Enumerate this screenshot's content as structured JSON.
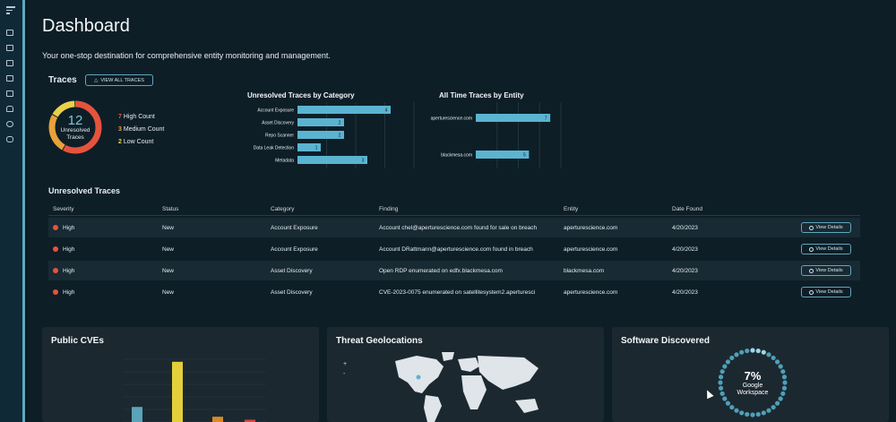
{
  "page": {
    "title": "Dashboard",
    "subtitle": "Your one-stop destination for comprehensive entity monitoring and management."
  },
  "sidebar": {
    "icons": [
      "menu-icon",
      "dashboard-icon",
      "list-icon",
      "report-icon",
      "layers-icon",
      "table-icon",
      "bell-icon",
      "gear-icon",
      "users-icon"
    ]
  },
  "traces": {
    "title": "Traces",
    "view_all": "VIEW ALL TRACES",
    "total": "12",
    "total_label": "Unresolved Traces",
    "counts": [
      {
        "n": "7",
        "label": "High Count",
        "color": "#e5533d"
      },
      {
        "n": "3",
        "label": "Medium Count",
        "color": "#e8a13a"
      },
      {
        "n": "2",
        "label": "Low Count",
        "color": "#e8d04a"
      }
    ],
    "donut": {
      "high": 7,
      "medium": 3,
      "low": 2,
      "colors": {
        "high": "#e5533d",
        "medium": "#e8a13a",
        "low": "#e8d04a"
      }
    }
  },
  "chart_data": [
    {
      "type": "bar",
      "orientation": "horizontal",
      "title": "Unresolved Traces by Category",
      "categories": [
        "Account Exposure",
        "Asset Discovery",
        "Repo Scanner",
        "Data Leak Detection",
        "Metadata"
      ],
      "values": [
        4,
        2,
        2,
        1,
        3
      ],
      "xlim": [
        0,
        5
      ],
      "color": "#5ab4d1"
    },
    {
      "type": "bar",
      "orientation": "horizontal",
      "title": "All Time Traces by Entity",
      "categories": [
        "aperturescience.com",
        "blackmesa.com"
      ],
      "values": [
        7,
        5
      ],
      "xlim": [
        0,
        8
      ],
      "color": "#5ab4d1"
    }
  ],
  "unresolved": {
    "title": "Unresolved Traces",
    "columns": [
      "Severity",
      "Status",
      "Category",
      "Finding",
      "Entity",
      "Date Found"
    ],
    "button_label": "View Details",
    "rows": [
      {
        "severity": "High",
        "status": "New",
        "category": "Account Exposure",
        "finding": "Account chel@aperturescience.com found for sale on breach",
        "entity": "aperturescience.com",
        "date": "4/20/2023"
      },
      {
        "severity": "High",
        "status": "New",
        "category": "Account Exposure",
        "finding": "Account DRattmann@aperturescience.com found in breach",
        "entity": "aperturescience.com",
        "date": "4/20/2023"
      },
      {
        "severity": "High",
        "status": "New",
        "category": "Asset Discovery",
        "finding": "Open RDP enumerated on edfx.blackmesa.com",
        "entity": "blackmesa.com",
        "date": "4/20/2023"
      },
      {
        "severity": "High",
        "status": "New",
        "category": "Asset Discovery",
        "finding": "CVE-2023-0075 enumerated on satellitesystem2.aperturesci",
        "entity": "aperturescience.com",
        "date": "4/20/2023"
      }
    ]
  },
  "panels": {
    "cves": {
      "title": "Public CVEs",
      "bars": [
        {
          "value": 0.2,
          "color": "#5aa3b8"
        },
        {
          "value": 0.8,
          "color": "#e3cf3a"
        },
        {
          "value": 0.07,
          "color": "#d68a2a"
        },
        {
          "value": 0.03,
          "color": "#d24a3a"
        }
      ]
    },
    "geo": {
      "title": "Threat Geolocations",
      "zoom_in": "+",
      "zoom_out": "-"
    },
    "software": {
      "title": "Software Discovered",
      "percent": "7%",
      "label": "Google Workspace",
      "progress": 0.07
    }
  }
}
